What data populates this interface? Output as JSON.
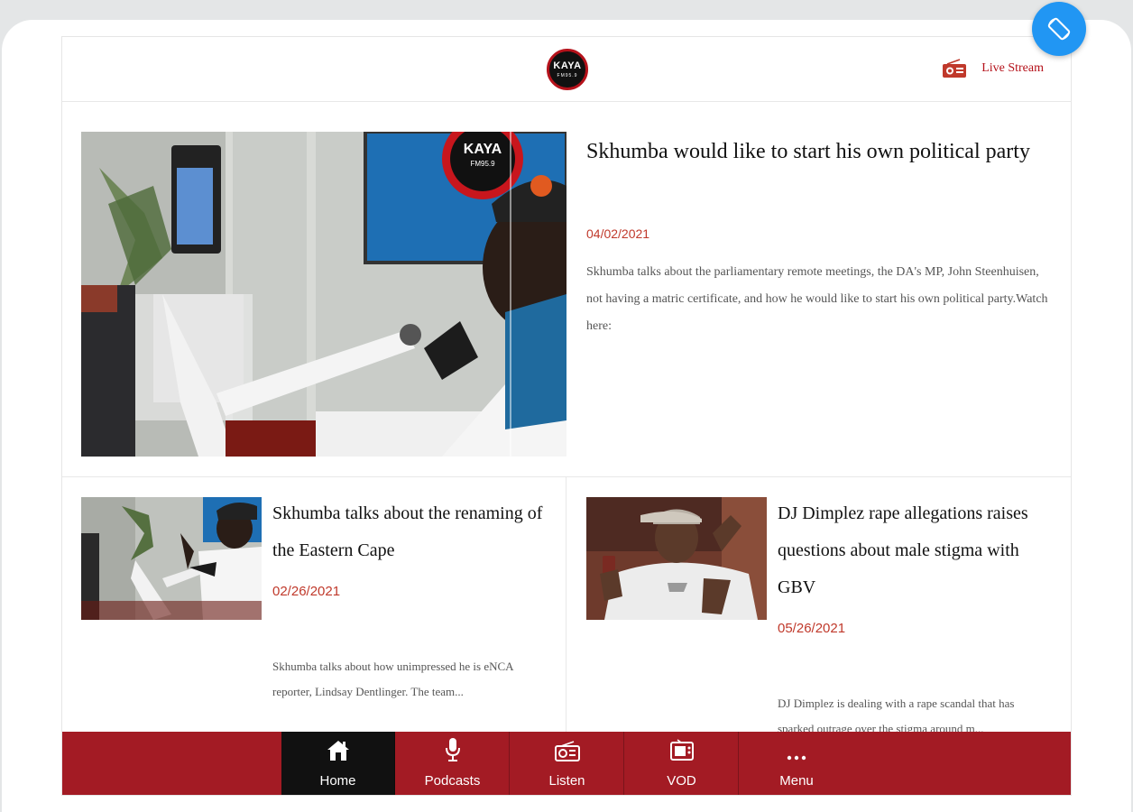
{
  "header": {
    "logo_text": "KAYA",
    "logo_sub": "FM95.9",
    "live_stream_label": "Live Stream"
  },
  "featured": {
    "title": "Skhumba would like to start his own political party",
    "date": "04/02/2021",
    "description": "Skhumba talks about the parliamentary remote meetings, the DA's MP, John Steenhuisen, not having a matric certificate, and how he would like to start his own political party.Watch here:",
    "studio_sign": "KAYA",
    "studio_sign_sub": "FM95.9"
  },
  "cards": [
    {
      "title": "Skhumba talks about the renaming of the Eastern Cape",
      "date": "02/26/2021",
      "description": "Skhumba talks about how unimpressed he is eNCA reporter, Lindsay Dentlinger. The team..."
    },
    {
      "title": "DJ Dimplez rape allegations raises questions about male stigma with GBV",
      "date": "05/26/2021",
      "description": "DJ Dimplez is dealing with a rape scandal that has sparked outrage over the stigma around m..."
    }
  ],
  "nav": {
    "items": [
      {
        "label": "Home",
        "icon": "home-icon",
        "active": true
      },
      {
        "label": "Podcasts",
        "icon": "microphone-icon"
      },
      {
        "label": "Listen",
        "icon": "radio-icon"
      },
      {
        "label": "VOD",
        "icon": "tv-icon"
      },
      {
        "label": "Menu",
        "icon": "more-icon"
      }
    ]
  },
  "colors": {
    "brand_red": "#a31b24",
    "date_red": "#c0392b",
    "rotate_blue": "#2196f3"
  }
}
